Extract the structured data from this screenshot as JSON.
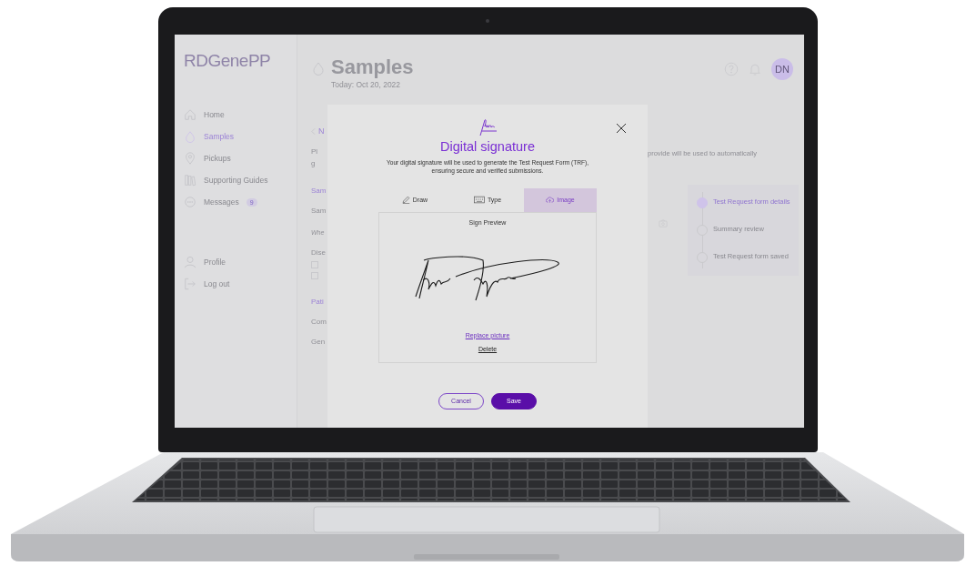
{
  "sidebar": {
    "logo": "RDGenePP",
    "items": [
      {
        "kind": "home",
        "label": "Home",
        "selected": false
      },
      {
        "kind": "drop",
        "label": "Samples",
        "selected": true
      },
      {
        "kind": "pin",
        "label": "Pickups",
        "selected": false
      },
      {
        "kind": "books",
        "label": "Supporting Guides",
        "selected": false
      },
      {
        "kind": "chat",
        "label": "Messages",
        "selected": false,
        "badge": "9"
      }
    ],
    "bottom_items": [
      {
        "kind": "person",
        "label": "Profile"
      },
      {
        "kind": "logout",
        "label": "Log out"
      }
    ]
  },
  "header": {
    "title": "Samples",
    "date": "Today: Oct 20, 2022",
    "avatar": "DN"
  },
  "background": {
    "fragments": [
      {
        "kind": "back",
        "text": "N"
      },
      {
        "kind": "text",
        "text": "Pl"
      },
      {
        "kind": "text",
        "text": "g"
      },
      {
        "kind": "heading",
        "text": "Sam"
      },
      {
        "kind": "label",
        "text": "Sam"
      },
      {
        "kind": "note",
        "text": "Whe"
      },
      {
        "kind": "label",
        "text": "Dise"
      },
      {
        "kind": "checkbox",
        "checked": false
      },
      {
        "kind": "checkbox",
        "checked": false
      },
      {
        "kind": "heading",
        "text": "Pati"
      },
      {
        "kind": "label",
        "text": "Com"
      },
      {
        "kind": "label",
        "text": "Gen"
      }
    ],
    "intro_tail": "provide will be used to automatically",
    "steps": [
      {
        "label": "Test Request form details",
        "selected": true
      },
      {
        "label": "Summary review",
        "selected": false
      },
      {
        "label": "Test Request form saved",
        "selected": false
      }
    ]
  },
  "dialog": {
    "title": "Digital signature",
    "description": "Your digital signature will be used to generate the Test Request Form (TRF), ensuring secure and verified submissions.",
    "tabs": [
      {
        "kind": "draw",
        "label": "Draw",
        "selected": false
      },
      {
        "kind": "type",
        "label": "Type",
        "selected": false
      },
      {
        "kind": "image",
        "label": "Image",
        "selected": true
      }
    ],
    "preview_title": "Sign Preview",
    "replace_link": "Replace picture",
    "delete_link": "Delete",
    "buttons": [
      {
        "kind": "secondary",
        "label": "Cancel"
      },
      {
        "kind": "primary",
        "label": "Save"
      }
    ]
  }
}
